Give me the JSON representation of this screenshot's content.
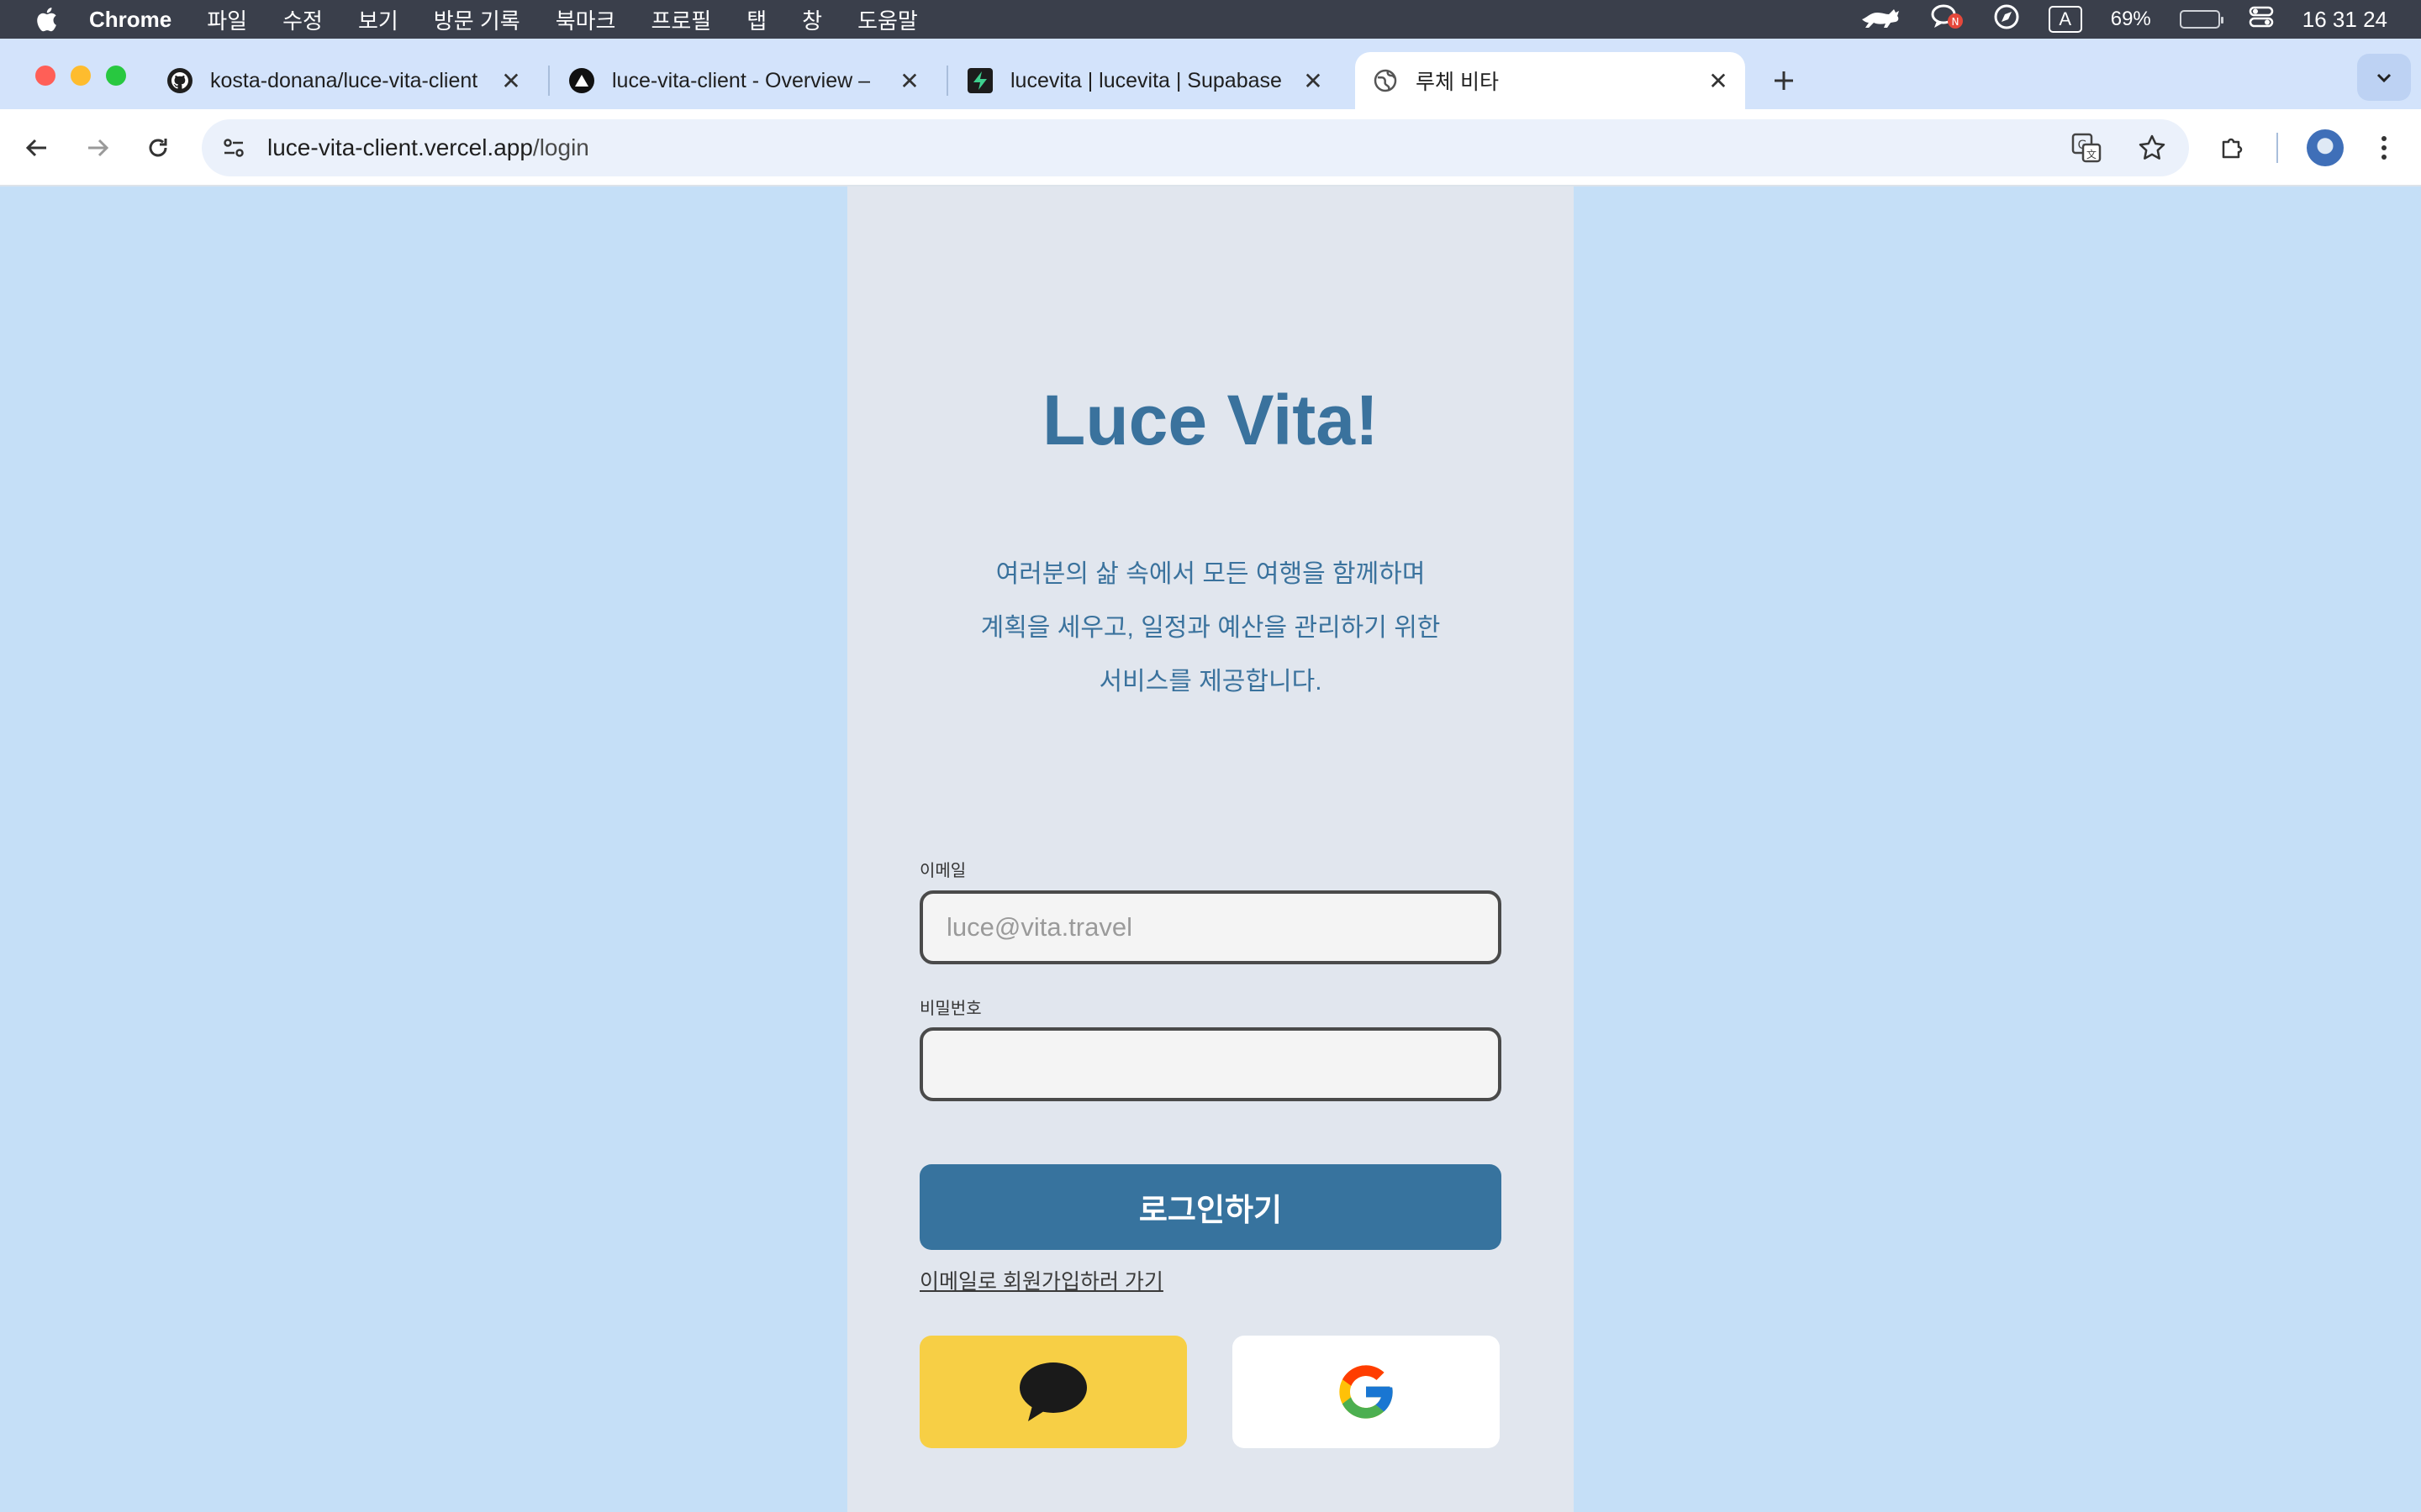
{
  "menubar": {
    "app_name": "Chrome",
    "items": [
      "파일",
      "수정",
      "보기",
      "방문 기록",
      "북마크",
      "프로필",
      "탭",
      "창",
      "도움말"
    ],
    "battery_percent": "69%",
    "battery_level": 0.69,
    "clock": "16 31 24",
    "input_indicator": "A"
  },
  "tabs": [
    {
      "title": "kosta-donana/luce-vita-client",
      "icon": "github-icon"
    },
    {
      "title": "luce-vita-client - Overview –",
      "icon": "vercel-icon"
    },
    {
      "title": "lucevita | lucevita | Supabase",
      "icon": "supabase-icon"
    },
    {
      "title": "루체 비타",
      "icon": "globe-icon",
      "active": true
    }
  ],
  "address_bar": {
    "host": "luce-vita-client.vercel.app",
    "path": "/login"
  },
  "login": {
    "title": "Luce Vita!",
    "tagline": [
      "여러분의 삶 속에서 모든 여행을 함께하며",
      "계획을 세우고, 일정과 예산을 관리하기 위한",
      "서비스를 제공합니다."
    ],
    "email_label": "이메일",
    "email_placeholder": "luce@vita.travel",
    "email_value": "",
    "password_label": "비밀번호",
    "password_value": "",
    "login_button": "로그인하기",
    "signup_link": "이메일로 회원가입하러 가기"
  },
  "colors": {
    "brand": "#3a729d",
    "page_background": "#c5dff7",
    "panel_background": "#e1e6ee",
    "kakao": "#f7cf45"
  }
}
